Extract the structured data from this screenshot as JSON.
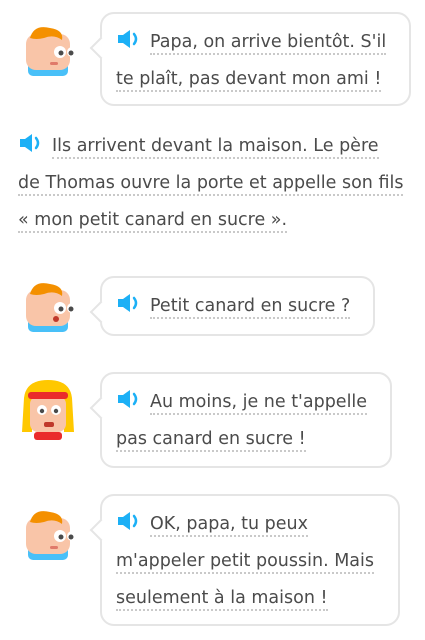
{
  "icons": {
    "speaker": "speaker-icon",
    "avatar_boy": "boy-avatar-icon",
    "avatar_girl": "girl-avatar-icon"
  },
  "colors": {
    "speaker_blue": "#1cb0f6",
    "border": "#e5e5e5",
    "text": "#4b4b4b",
    "skin": "#f9c5a8",
    "hair_orange": "#f49000",
    "shirt_blue": "#49c0f8",
    "hair_yellow": "#ffc800",
    "headband_red": "#ea2b2b"
  },
  "dialogue": [
    {
      "lines": [
        "Papa, on arrive bientôt. S'il",
        "te plaît, pas devant mon ami !"
      ]
    },
    {
      "lines": [
        "Ils arrivent devant la maison. Le père",
        "de Thomas ouvre la porte et appelle son fils",
        "« mon petit canard en sucre »."
      ]
    },
    {
      "lines": [
        "Petit canard en sucre ?"
      ]
    },
    {
      "lines": [
        "Au moins, je ne t'appelle",
        "pas canard en sucre !"
      ]
    },
    {
      "lines": [
        "OK, papa, tu peux",
        "m'appeler petit poussin. Mais",
        "seulement à la maison !"
      ]
    }
  ]
}
